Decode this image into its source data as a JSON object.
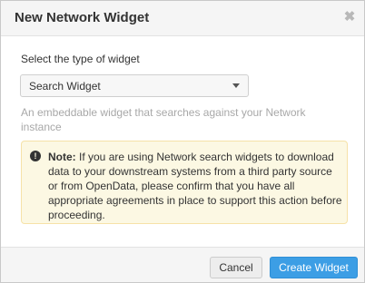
{
  "dialog": {
    "title": "New Network Widget",
    "close_icon": "close-icon",
    "close_glyph": "✖"
  },
  "form": {
    "select_label": "Select the type of widget",
    "selected_widget": "Search Widget",
    "help_text": "An embeddable widget that searches against your Network instance"
  },
  "note": {
    "icon": "exclamation-circle-icon",
    "icon_glyph": "!",
    "label": "Note:",
    "text": " If you are using Network search widgets to download data to your downstream systems from a third party source or from OpenData, please confirm that you have all appropriate agreements in place to support this action before proceeding."
  },
  "footer": {
    "cancel_label": "Cancel",
    "create_label": "Create Widget"
  },
  "colors": {
    "primary_button": "#3c9ee5",
    "note_background": "#fcf8e3",
    "note_border": "#f6e2a8",
    "header_background": "#f5f5f5"
  }
}
